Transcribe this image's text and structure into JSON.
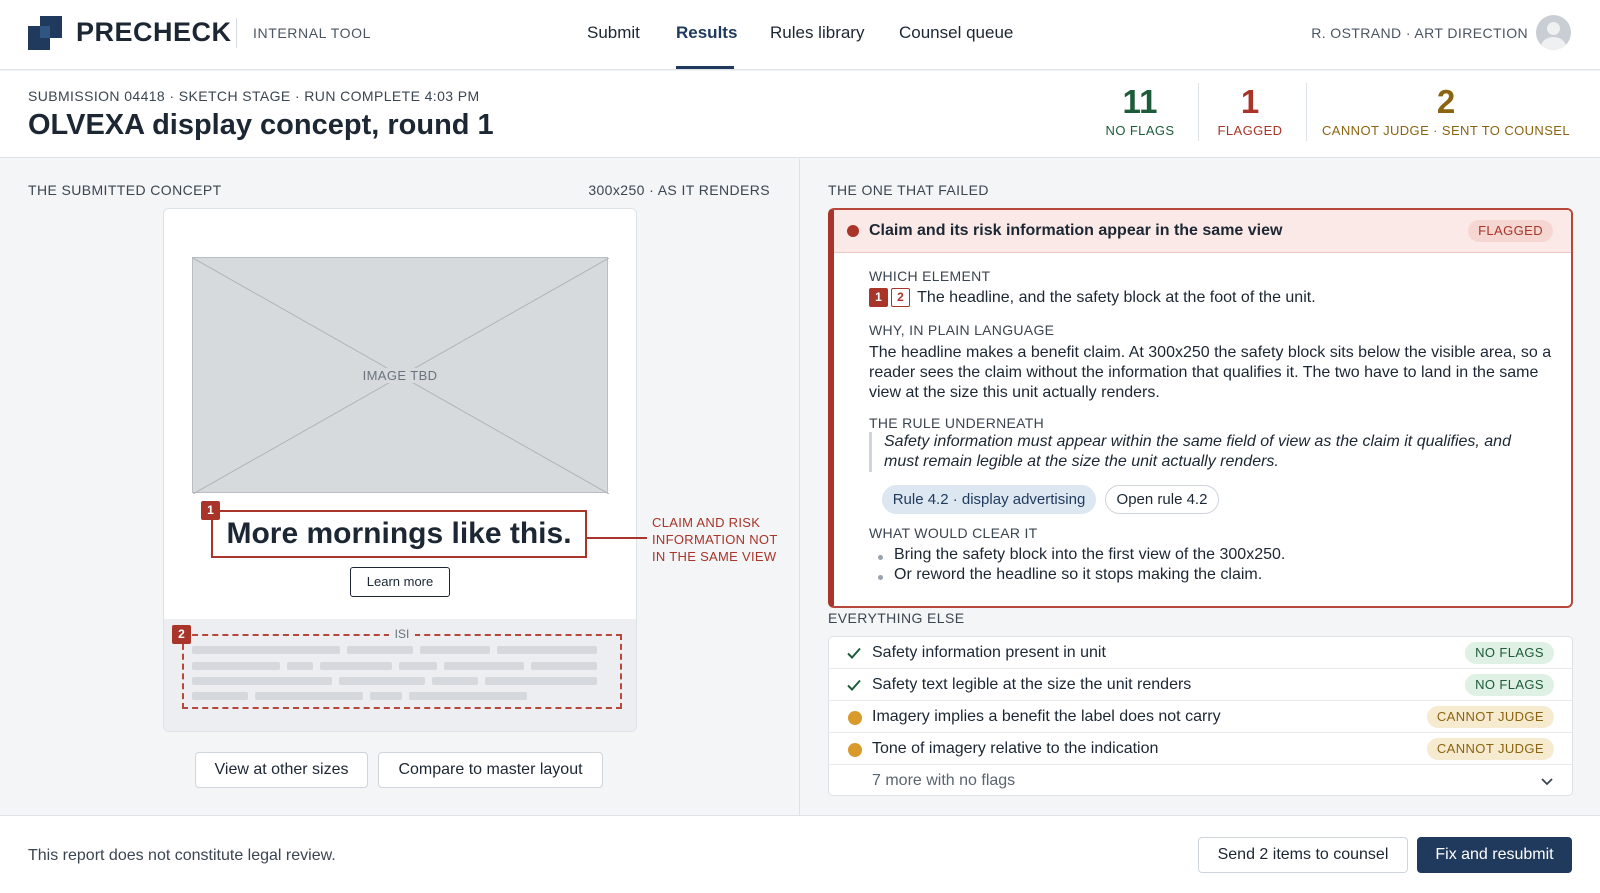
{
  "app": {
    "brand": "PRECHECK",
    "subtitle": "INTERNAL TOOL",
    "nav": [
      "Submit",
      "Results",
      "Rules library",
      "Counsel queue"
    ],
    "active_nav": "Results",
    "user": "R. OSTRAND · ART DIRECTION"
  },
  "header": {
    "meta": "SUBMISSION 04418 · SKETCH STAGE · RUN COMPLETE 4:03 PM",
    "title": "OLVEXA display concept, round 1",
    "stats": [
      {
        "value": "11",
        "label": "NO FLAGS",
        "color": "#1d5c3a"
      },
      {
        "value": "1",
        "label": "FLAGGED",
        "color": "#a8342a"
      },
      {
        "value": "2",
        "label": "CANNOT JUDGE · SENT TO COUNSEL",
        "color": "#8a6410"
      }
    ]
  },
  "concept": {
    "section_label": "THE SUBMITTED CONCEPT",
    "size_label": "300x250 · AS IT RENDERS",
    "image_placeholder": "IMAGE TBD",
    "headline": "More mornings like this.",
    "cta": "Learn more",
    "isi_label": "ISI",
    "marker_1": "1",
    "marker_2": "2",
    "callout": [
      "CLAIM AND RISK",
      "INFORMATION NOT",
      "IN THE SAME VIEW"
    ],
    "buttons": {
      "other_sizes": "View at other sizes",
      "compare": "Compare to master layout"
    }
  },
  "failed": {
    "section_label": "THE ONE THAT FAILED",
    "title": "Claim and its risk information appear in the same view",
    "badge": "FLAGGED",
    "which_label": "WHICH ELEMENT",
    "which_markers": [
      "1",
      "2"
    ],
    "which_text": "The headline, and the safety block at the foot of the unit.",
    "why_label": "WHY, IN PLAIN LANGUAGE",
    "why_text": "The headline makes a benefit claim. At 300x250 the safety block sits below the visible area, so a reader sees the claim without the information that qualifies it. The two have to land in the same view at the size this unit actually renders.",
    "rule_label": "THE RULE UNDERNEATH",
    "rule_text": "Safety information must appear within the same field of view as the claim it qualifies, and must remain legible at the size the unit actually renders.",
    "rule_pill": "Rule 4.2 · display advertising",
    "open_rule": "Open rule 4.2",
    "clear_label": "WHAT WOULD CLEAR IT",
    "clear_items": [
      "Bring the safety block into the first view of the 300x250.",
      "Or reword the headline so it stops making the claim."
    ]
  },
  "everything_else": {
    "section_label": "EVERYTHING ELSE",
    "rows": [
      {
        "text": "Safety information present in unit",
        "status": "NO FLAGS",
        "icon": "check-icon"
      },
      {
        "text": "Safety text legible at the size the unit renders",
        "status": "NO FLAGS",
        "icon": "check-icon"
      },
      {
        "text": "Imagery implies a benefit the label does not carry",
        "status": "CANNOT JUDGE",
        "icon": "amber-dot-icon"
      },
      {
        "text": "Tone of imagery relative to the indication",
        "status": "CANNOT JUDGE",
        "icon": "amber-dot-icon"
      }
    ],
    "more": "7 more with no flags"
  },
  "footer": {
    "disclaimer": "This report does not constitute legal review.",
    "send_button": "Send 2 items to counsel",
    "primary_button": "Fix and resubmit"
  },
  "colors": {
    "brand": "#1f3a5c",
    "flag_red": "#a8342a",
    "ok_green": "#1d5c3a",
    "amber": "#8a6410",
    "amber_dot": "#d89b2b"
  }
}
